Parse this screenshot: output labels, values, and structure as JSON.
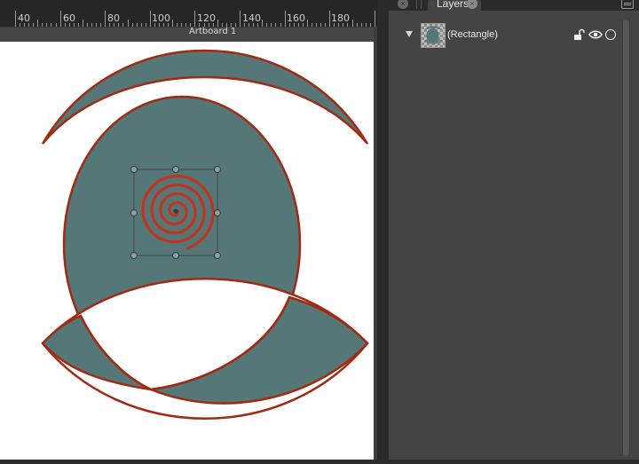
{
  "ruler": {
    "labels": [
      "40",
      "60",
      "80",
      "100",
      "120",
      "140",
      "160",
      "180"
    ]
  },
  "artboard": {
    "label": "Artboard 1"
  },
  "panel": {
    "tab_label": "Layers",
    "layer_row": {
      "name": "(Rectangle)",
      "locked": false,
      "visible": true
    }
  },
  "colors": {
    "shape_fill": "#567777",
    "shape_stroke": "#a12a12",
    "spiral": "#c0341c",
    "panel_bg": "#444444",
    "canvas_bg": "#ffffff"
  }
}
